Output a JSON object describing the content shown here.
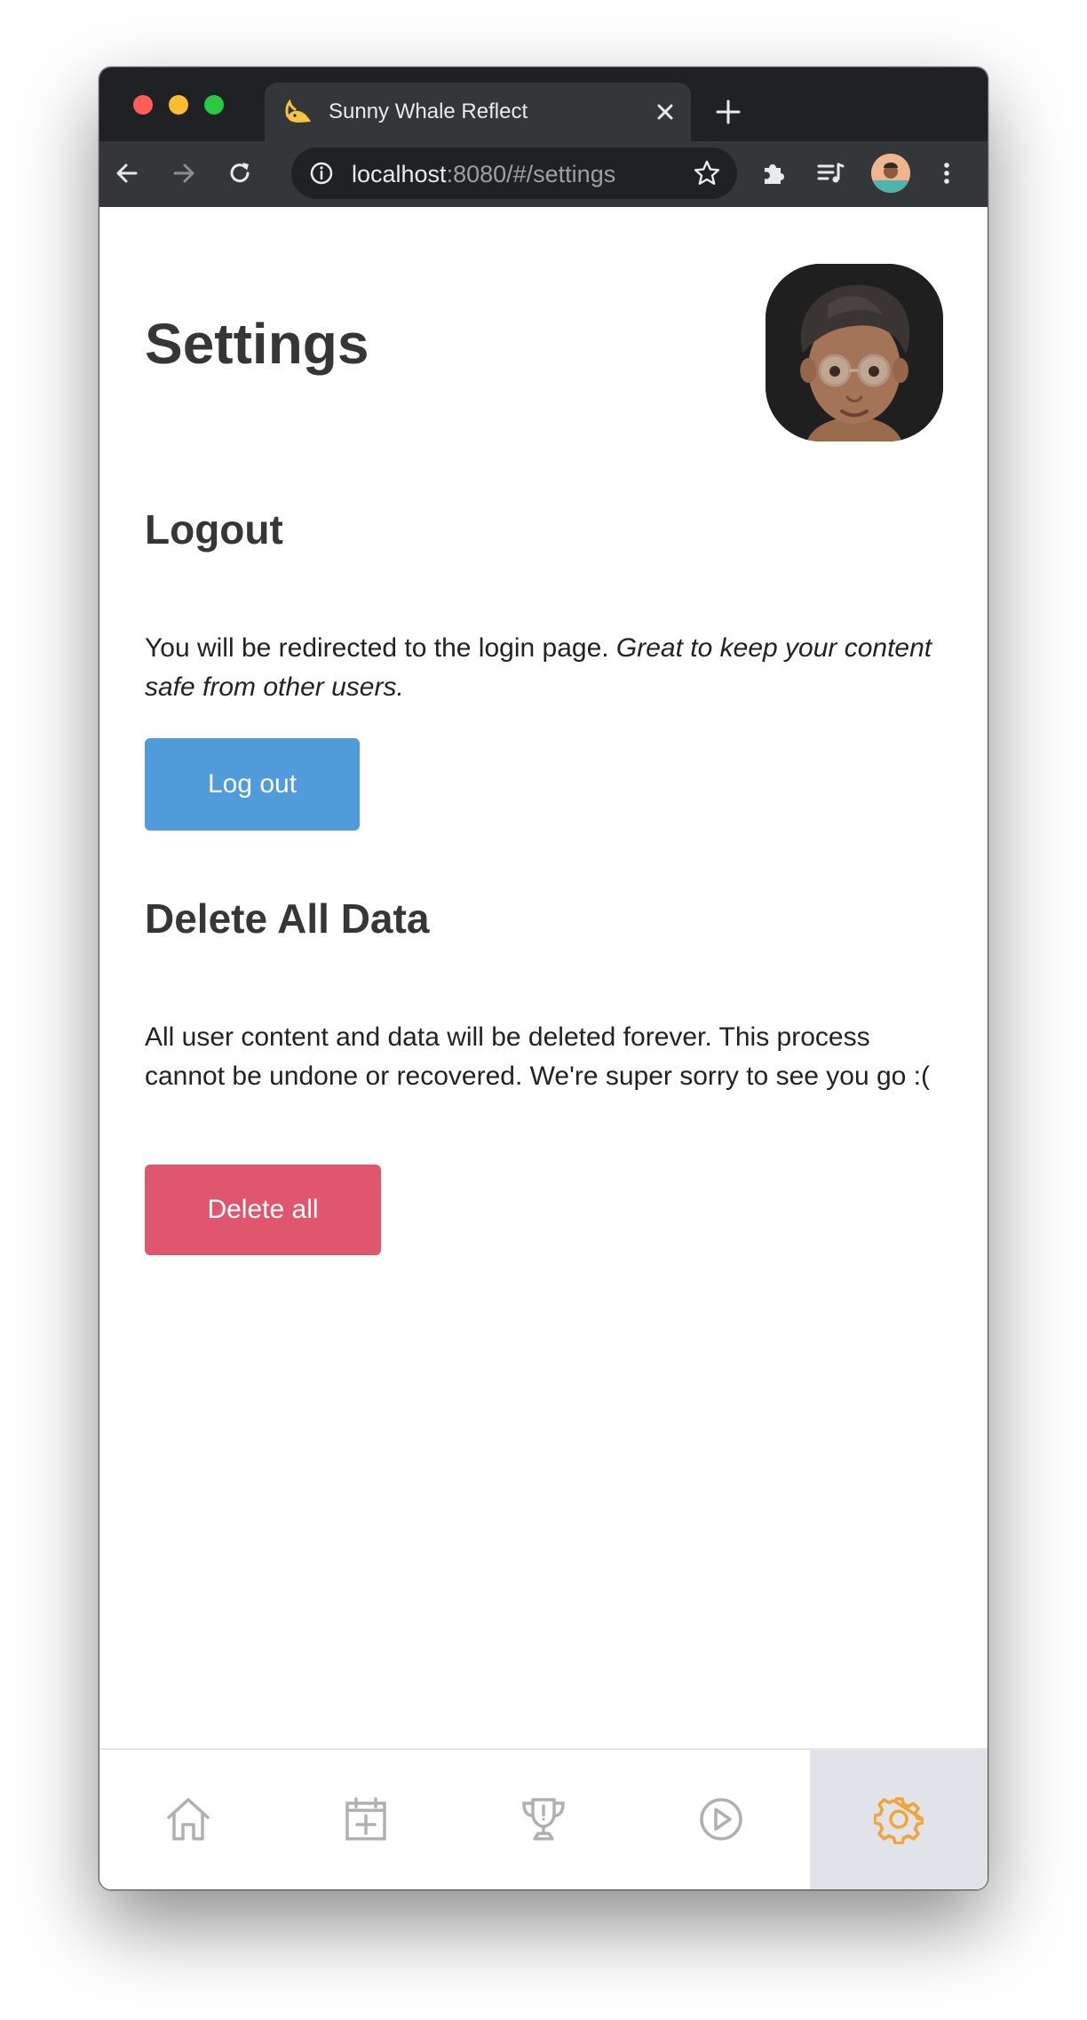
{
  "browser": {
    "tab_title": "Sunny Whale Reflect",
    "url_host": "localhost",
    "url_rest": ":8080/#/settings"
  },
  "page": {
    "title": "Settings"
  },
  "logout": {
    "heading": "Logout",
    "text_plain": "You will be redirected to the login page. ",
    "text_italic": "Great to keep your content safe from other users.",
    "button_label": "Log out"
  },
  "delete_all": {
    "heading": "Delete All Data",
    "text": "All user content and data will be deleted forever. This process cannot be undone or recovered. We're super sorry to see you go :(",
    "button_label": "Delete all"
  },
  "bottom_nav": {
    "items": [
      {
        "icon": "home-icon",
        "active": false
      },
      {
        "icon": "calendar-add-icon",
        "active": false
      },
      {
        "icon": "trophy-icon",
        "active": false
      },
      {
        "icon": "play-icon",
        "active": false
      },
      {
        "icon": "gear-icon",
        "active": true
      }
    ],
    "active_color": "#f2a33a",
    "inactive_color": "#b0b0b0"
  },
  "colors": {
    "logout_button": "#509bd9",
    "delete_button": "#e1566f",
    "traffic_red": "#ff5f57",
    "traffic_yellow": "#febc2e",
    "traffic_green": "#28c840"
  }
}
